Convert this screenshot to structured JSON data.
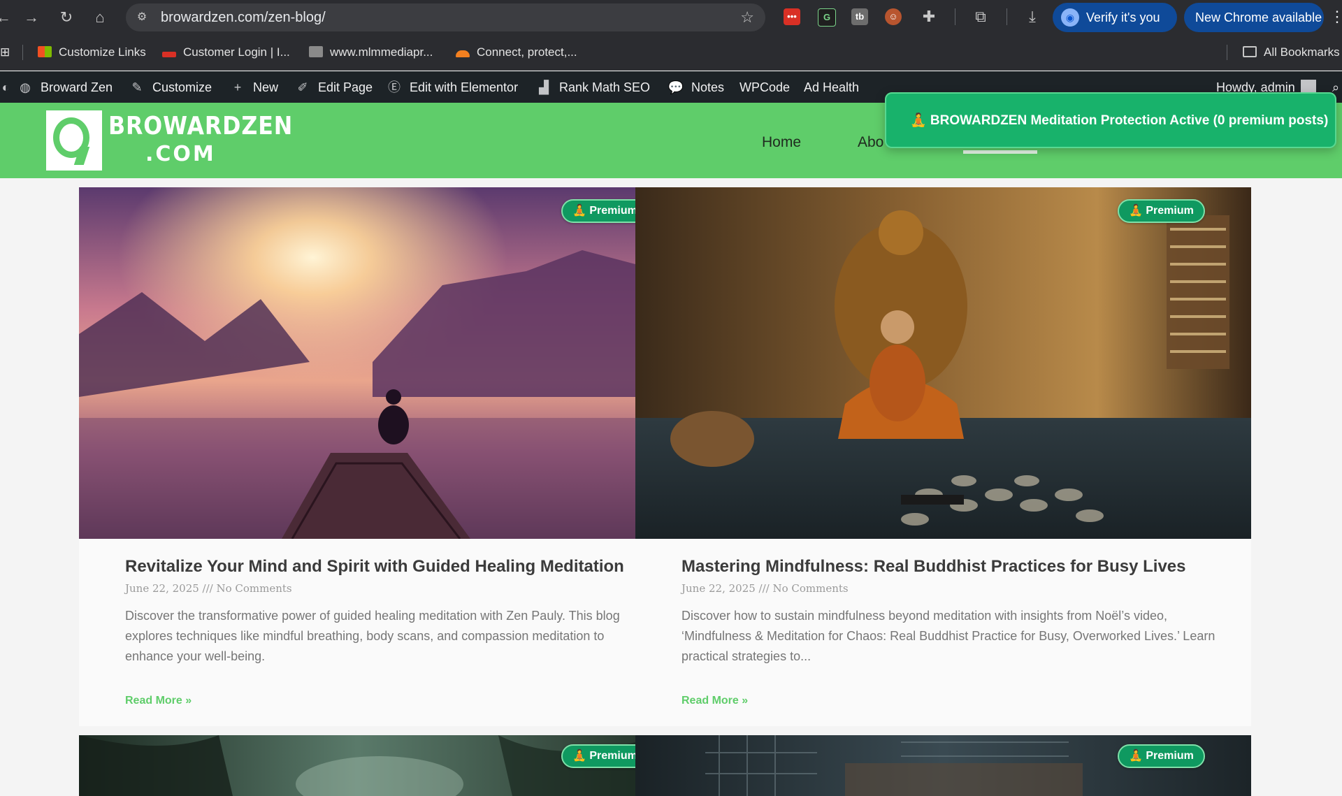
{
  "browser": {
    "url": "browardzen.com/zen-blog/",
    "verify_label": "Verify it's you",
    "update_label": "New Chrome available",
    "bookmarks": [
      "Customize Links",
      "Customer Login | I...",
      "www.mlmmediapr...",
      "Connect, protect,..."
    ],
    "all_bookmarks": "All Bookmarks"
  },
  "admin_bar": {
    "site": "Broward Zen",
    "customize": "Customize",
    "new": "New",
    "edit_page": "Edit Page",
    "elementor": "Edit with Elementor",
    "rankmath": "Rank Math SEO",
    "notes": "Notes",
    "wpcode": "WPCode",
    "ad_health": "Ad Health",
    "howdy": "Howdy, admin"
  },
  "site": {
    "logo_line1": "BROWARDZEN",
    "logo_line2": ".COM",
    "nav": [
      "Home",
      "Abo"
    ]
  },
  "toast": {
    "text": "🧘 BROWARDZEN Meditation Protection Active (0 premium posts)"
  },
  "badge_label": "🧘 Premium",
  "posts": [
    {
      "title": "Revitalize Your Mind and Spirit with Guided Healing Meditation",
      "meta": "June 22, 2025 /// No Comments",
      "excerpt": "Discover the transformative power of guided healing meditation with Zen Pauly. This blog explores techniques like mindful breathing, body scans, and compassion meditation to enhance your well-being.",
      "read_more": "Read More »"
    },
    {
      "title": "Mastering Mindfulness: Real Buddhist Practices for Busy Lives",
      "meta": "June 22, 2025 /// No Comments",
      "excerpt": "Discover how to sustain mindfulness beyond meditation with insights from Noël’s video, ‘Mindfulness & Meditation for Chaos: Real Buddhist Practice for Busy, Overworked Lives.’ Learn practical strategies to...",
      "read_more": "Read More »"
    }
  ],
  "colors": {
    "brand_green": "#5fcd6a",
    "badge_green": "#0f9960",
    "toast_green": "#18b26b",
    "admin_bar": "#1d2327"
  }
}
